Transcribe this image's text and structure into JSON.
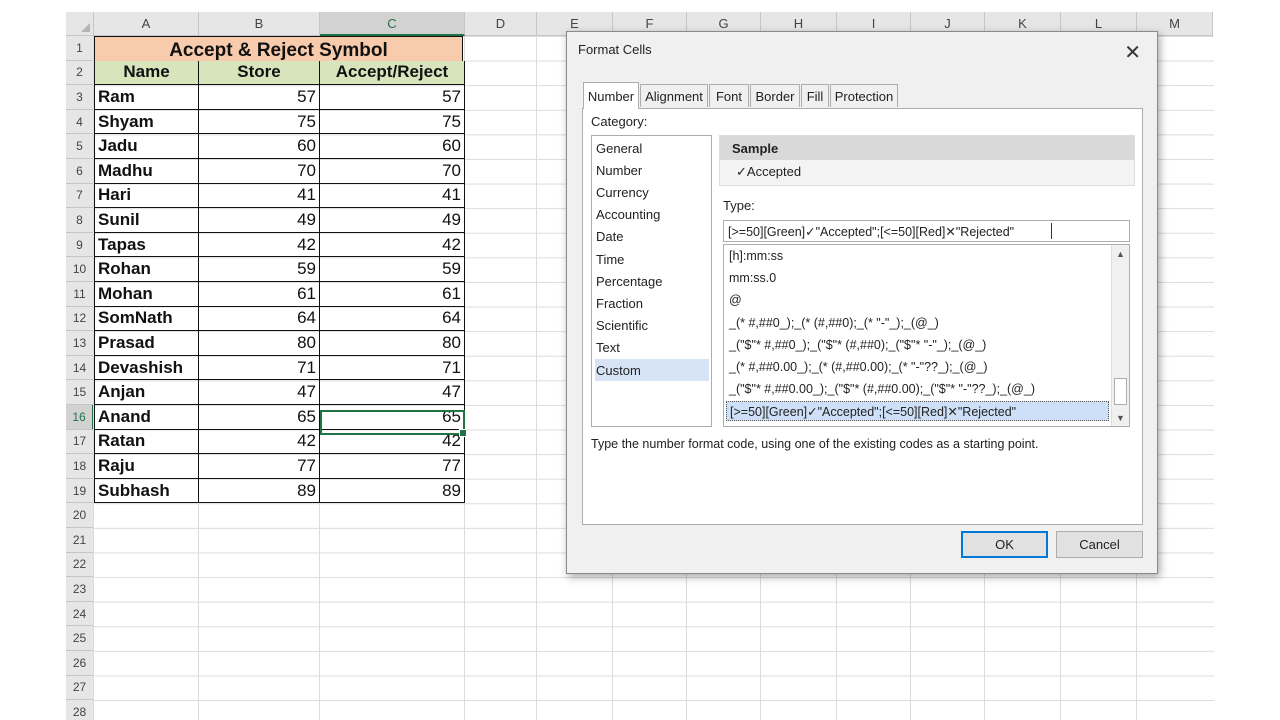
{
  "spreadsheet": {
    "columns": [
      "A",
      "B",
      "C",
      "D",
      "E",
      "F",
      "G",
      "H",
      "I",
      "J",
      "K",
      "L",
      "M"
    ],
    "rows": [
      "1",
      "2",
      "3",
      "4",
      "5",
      "6",
      "7",
      "8",
      "9",
      "10",
      "11",
      "12",
      "13",
      "14",
      "15",
      "16",
      "17",
      "18",
      "19",
      "20",
      "21",
      "22",
      "23",
      "24",
      "25",
      "26",
      "27",
      "28"
    ],
    "selected_cell": "C16",
    "title": "Accept & Reject Symbol",
    "headers": [
      "Name",
      "Store",
      "Accept/Reject"
    ],
    "data": [
      {
        "name": "Ram",
        "store": "57",
        "accept": "57"
      },
      {
        "name": "Shyam",
        "store": "75",
        "accept": "75"
      },
      {
        "name": "Jadu",
        "store": "60",
        "accept": "60"
      },
      {
        "name": "Madhu",
        "store": "70",
        "accept": "70"
      },
      {
        "name": "Hari",
        "store": "41",
        "accept": "41"
      },
      {
        "name": "Sunil",
        "store": "49",
        "accept": "49"
      },
      {
        "name": "Tapas",
        "store": "42",
        "accept": "42"
      },
      {
        "name": "Rohan",
        "store": "59",
        "accept": "59"
      },
      {
        "name": "Mohan",
        "store": "61",
        "accept": "61"
      },
      {
        "name": "SomNath",
        "store": "64",
        "accept": "64"
      },
      {
        "name": "Prasad",
        "store": "80",
        "accept": "80"
      },
      {
        "name": "Devashish",
        "store": "71",
        "accept": "71"
      },
      {
        "name": "Anjan",
        "store": "47",
        "accept": "47"
      },
      {
        "name": "Anand",
        "store": "65",
        "accept": "65"
      },
      {
        "name": "Ratan",
        "store": "42",
        "accept": "42"
      },
      {
        "name": "Raju",
        "store": "77",
        "accept": "77"
      },
      {
        "name": "Subhash",
        "store": "89",
        "accept": "89"
      }
    ],
    "colors": {
      "title_fill": "#f8cbad",
      "header_fill": "#d8e4bc",
      "selection": "#217346"
    }
  },
  "dialog": {
    "title": "Format Cells",
    "close_icon": "close-icon",
    "tabs": [
      "Number",
      "Alignment",
      "Font",
      "Border",
      "Fill",
      "Protection"
    ],
    "active_tab": "Number",
    "category_label": "Category:",
    "categories": [
      "General",
      "Number",
      "Currency",
      "Accounting",
      "Date",
      "Time",
      "Percentage",
      "Fraction",
      "Scientific",
      "Text",
      "Custom"
    ],
    "selected_category": "Custom",
    "sample_label": "Sample",
    "sample_value": "✓Accepted",
    "type_label": "Type:",
    "type_value": "[>=50][Green]✓\"Accepted\";[<=50][Red]✕\"Rejected\"",
    "type_list": [
      "[h]:mm:ss",
      "mm:ss.0",
      "@",
      "_(* #,##0_);_(* (#,##0);_(* \"-\"_);_(@_)",
      "_(\"$\"* #,##0_);_(\"$\"* (#,##0);_(\"$\"* \"-\"_);_(@_)",
      "_(* #,##0.00_);_(* (#,##0.00);_(* \"-\"??_);_(@_)",
      "_(\"$\"* #,##0.00_);_(\"$\"* (#,##0.00);_(\"$\"* \"-\"??_);_(@_)",
      "[>=50][Green]✓\"Accepted\";[<=50][Red]✕\"Rejected\""
    ],
    "hint": "Type the number format code, using one of the existing codes as a starting point.",
    "ok_label": "OK",
    "cancel_label": "Cancel"
  }
}
